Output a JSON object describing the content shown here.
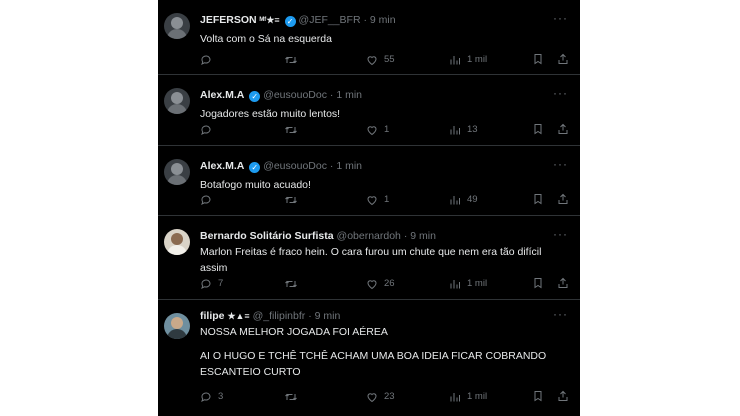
{
  "tweets": [
    {
      "name": "JEFERSON",
      "badge": "ᴹᶠ★≡",
      "verified": true,
      "handle": "@JEF__BFR",
      "time": "9 min",
      "lines": [
        "Volta com o Sá na esquerda"
      ],
      "replies": "",
      "retweets": "",
      "likes": "55",
      "views": "1 mil"
    },
    {
      "name": "Alex.M.A",
      "badge": "",
      "verified": true,
      "handle": "@eusouoDoc",
      "time": "1 min",
      "lines": [
        "Jogadores estão muito lentos!"
      ],
      "replies": "",
      "retweets": "",
      "likes": "1",
      "views": "13"
    },
    {
      "name": "Alex.M.A",
      "badge": "",
      "verified": true,
      "handle": "@eusouoDoc",
      "time": "1 min",
      "lines": [
        "Botafogo muito acuado!"
      ],
      "replies": "",
      "retweets": "",
      "likes": "1",
      "views": "49"
    },
    {
      "name": "Bernardo Solitário Surfista",
      "badge": "",
      "verified": false,
      "handle": "@obernardoh",
      "time": "9 min",
      "lines": [
        "Marlon Freitas é fraco hein. O cara furou um chute que nem era tão difícil",
        "assim"
      ],
      "replies": "7",
      "retweets": "",
      "likes": "26",
      "views": "1 mil"
    },
    {
      "name": "filipe",
      "badge": "★▲≡",
      "verified": false,
      "handle": "@_filipinbfr",
      "time": "9 min",
      "lines": [
        "NOSSA MELHOR JOGADA FOI AÉREA",
        "",
        "AI O HUGO E TCHÊ TCHÊ ACHAM UMA BOA IDEIA FICAR COBRANDO",
        "ESCANTEIO CURTO"
      ],
      "replies": "3",
      "retweets": "",
      "likes": "23",
      "views": "1 mil"
    }
  ],
  "ui": {
    "dot": "·",
    "verified_mark": "✓",
    "more": "···"
  }
}
